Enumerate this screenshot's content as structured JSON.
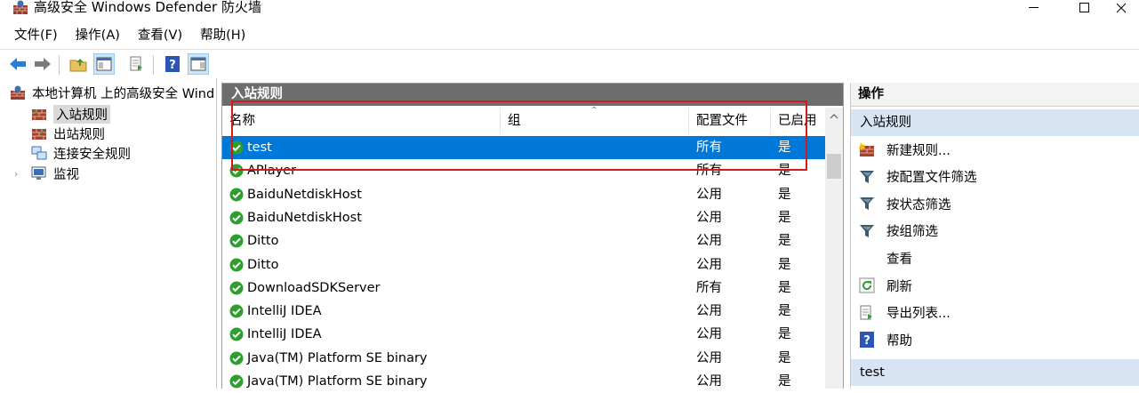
{
  "window": {
    "title": "高级安全 Windows Defender 防火墙",
    "controls": [
      "minimize-icon",
      "maximize-icon",
      "close-icon"
    ]
  },
  "menu": {
    "items": [
      "文件(F)",
      "操作(A)",
      "查看(V)",
      "帮助(H)"
    ]
  },
  "toolbar": {
    "buttons": [
      "back-arrow-icon",
      "forward-arrow-icon",
      "up-folder-icon",
      "show-hide-console-tree-icon",
      "export-list-icon",
      "help-icon",
      "show-hide-action-pane-icon"
    ]
  },
  "tree": {
    "root": "本地计算机 上的高级安全 Wind",
    "items": [
      {
        "label": "入站规则",
        "selected": true
      },
      {
        "label": "出站规则",
        "selected": false
      },
      {
        "label": "连接安全规则",
        "selected": false
      },
      {
        "label": "监视",
        "selected": false
      }
    ]
  },
  "center": {
    "header": "入站规则",
    "columns": [
      "名称",
      "组",
      "配置文件",
      "已启用"
    ],
    "rows": [
      {
        "name": "test",
        "group": "",
        "profile": "所有",
        "enabled": "是",
        "selected": true
      },
      {
        "name": "APlayer",
        "group": "",
        "profile": "所有",
        "enabled": "是",
        "selected": false
      },
      {
        "name": "BaiduNetdiskHost",
        "group": "",
        "profile": "公用",
        "enabled": "是",
        "selected": false
      },
      {
        "name": "BaiduNetdiskHost",
        "group": "",
        "profile": "公用",
        "enabled": "是",
        "selected": false
      },
      {
        "name": "Ditto",
        "group": "",
        "profile": "公用",
        "enabled": "是",
        "selected": false
      },
      {
        "name": "Ditto",
        "group": "",
        "profile": "公用",
        "enabled": "是",
        "selected": false
      },
      {
        "name": "DownloadSDKServer",
        "group": "",
        "profile": "所有",
        "enabled": "是",
        "selected": false
      },
      {
        "name": "IntelliJ IDEA",
        "group": "",
        "profile": "公用",
        "enabled": "是",
        "selected": false
      },
      {
        "name": "IntelliJ IDEA",
        "group": "",
        "profile": "公用",
        "enabled": "是",
        "selected": false
      },
      {
        "name": "Java(TM) Platform SE binary",
        "group": "",
        "profile": "公用",
        "enabled": "是",
        "selected": false
      },
      {
        "name": "Java(TM) Platform SE binary",
        "group": "",
        "profile": "公用",
        "enabled": "是",
        "selected": false
      }
    ]
  },
  "actions": {
    "header": "操作",
    "section1": "入站规则",
    "items": [
      {
        "label": "新建规则...",
        "icon": "new-rule-icon"
      },
      {
        "label": "按配置文件筛选",
        "icon": "filter-icon"
      },
      {
        "label": "按状态筛选",
        "icon": "filter-icon"
      },
      {
        "label": "按组筛选",
        "icon": "filter-icon"
      },
      {
        "label": "查看",
        "icon": ""
      },
      {
        "label": "刷新",
        "icon": "refresh-icon"
      },
      {
        "label": "导出列表...",
        "icon": "export-list-icon"
      },
      {
        "label": "帮助",
        "icon": "help-icon"
      }
    ],
    "section2": "test"
  },
  "colors": {
    "selection": "#0078d7",
    "header_dark": "#6d6d6d",
    "section_blue": "#d6e4f3",
    "highlight_box": "#d11a1a",
    "allow_green": "#2e9e2e"
  }
}
